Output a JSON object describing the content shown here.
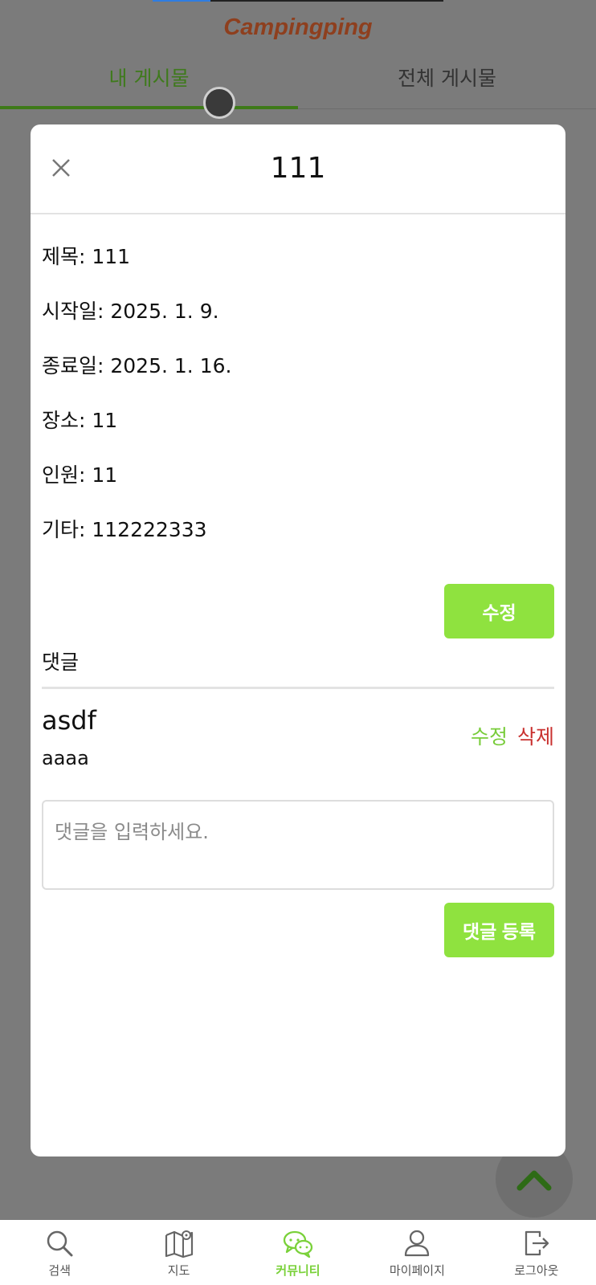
{
  "app": {
    "title": "Campingping"
  },
  "tabs": [
    {
      "label": "내 게시물",
      "active": true
    },
    {
      "label": "전체 게시물",
      "active": false
    }
  ],
  "modal": {
    "title": "111",
    "close_icon": "close-icon",
    "fields": [
      {
        "label": "제목: ",
        "value": "111"
      },
      {
        "label": "시작일: ",
        "value": "2025. 1. 9."
      },
      {
        "label": "종료일: ",
        "value": "2025. 1. 16."
      },
      {
        "label": "장소: ",
        "value": "11"
      },
      {
        "label": "인원: ",
        "value": "11"
      },
      {
        "label": "기타: ",
        "value": "112222333"
      }
    ],
    "edit_button": "수정",
    "comments_label": "댓글",
    "comments": [
      {
        "author": "asdf",
        "text": "aaaa",
        "edit_label": "수정",
        "delete_label": "삭제"
      }
    ],
    "comment_input": {
      "placeholder": "댓글을 입력하세요.",
      "value": ""
    },
    "register_button": "댓글 등록"
  },
  "bottom_nav": [
    {
      "label": "검색",
      "icon": "search-icon",
      "active": false
    },
    {
      "label": "지도",
      "icon": "map-icon",
      "active": false
    },
    {
      "label": "커뮤니티",
      "icon": "chat-icon",
      "active": true
    },
    {
      "label": "마이페이지",
      "icon": "user-icon",
      "active": false
    },
    {
      "label": "로그아웃",
      "icon": "logout-icon",
      "active": false
    }
  ],
  "colors": {
    "accent_green": "#8fe23f",
    "tab_active": "#3e7a18",
    "delete_red": "#c9312f",
    "brand": "#8e3f1e"
  }
}
